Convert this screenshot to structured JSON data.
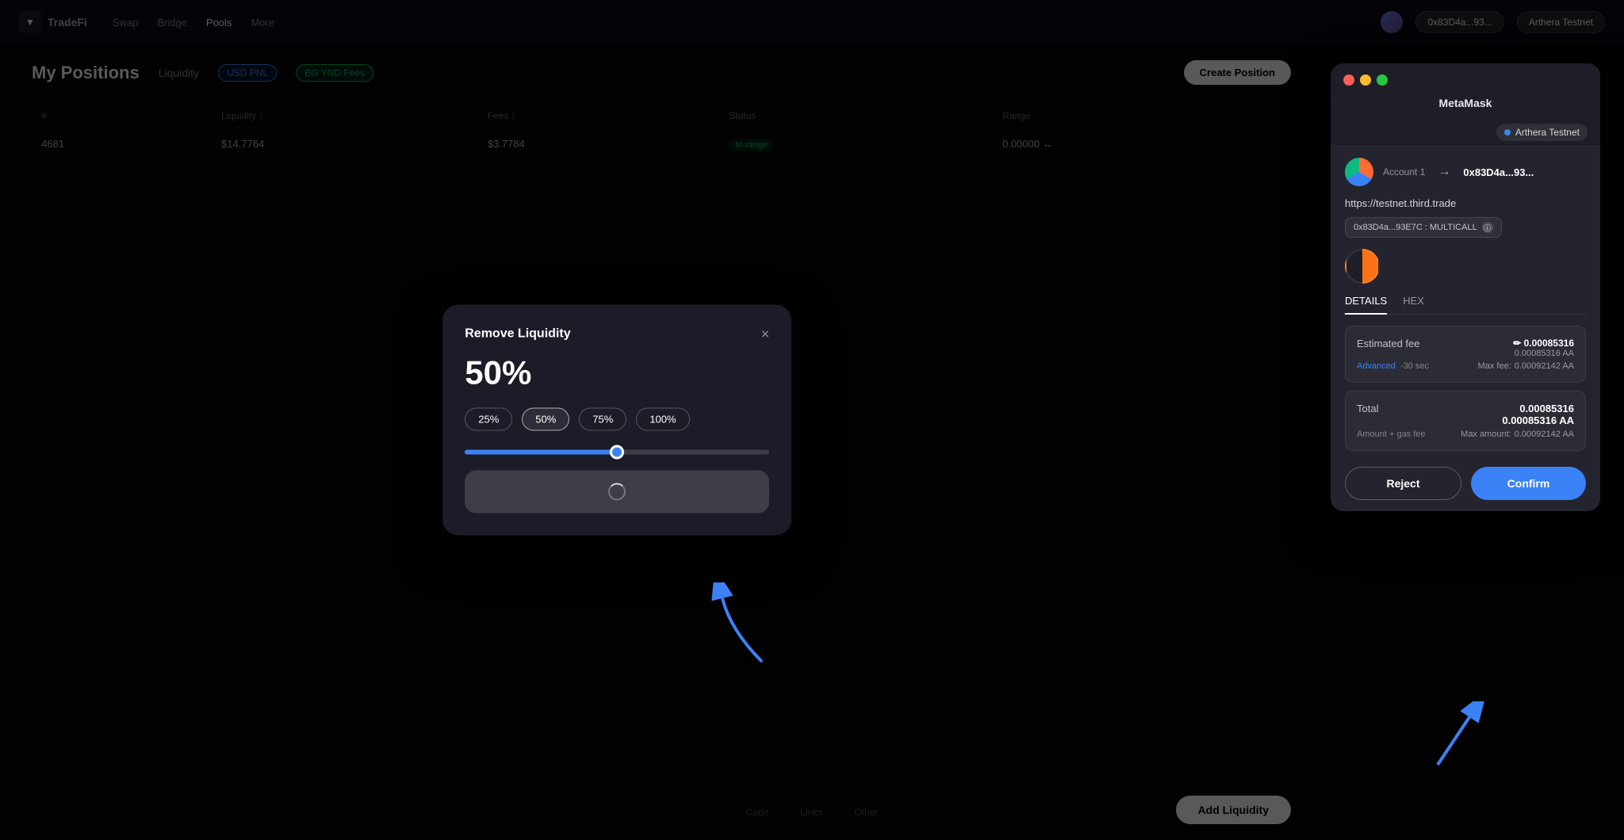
{
  "app": {
    "title": "TradeFi",
    "nav_links": [
      "Swap",
      "Bridge",
      "Pools",
      "More"
    ],
    "wallet_address": "0x83D4a...93...",
    "network_label": "Arthera Testnet"
  },
  "page": {
    "title": "My Positions",
    "tabs": [
      "Liquidity",
      "USD PNL",
      "BG YND Fees"
    ],
    "create_button": "Create Position",
    "table_headers": [
      "#",
      "Liquidity ↑",
      "Fees ↑",
      "Status",
      "Range"
    ],
    "table_row": {
      "id": "4681",
      "liquidity": "$14.7764",
      "fees": "$3.7784",
      "status": "In range",
      "range": "0.00000 ↔"
    }
  },
  "modal": {
    "title": "Remove Liquidity",
    "close_label": "×",
    "percent_display": "50%",
    "percent_buttons": [
      "25%",
      "50%",
      "75%",
      "100%"
    ],
    "active_percent": "50%",
    "slider_value": 50,
    "loading_button_label": ""
  },
  "metamask": {
    "window_title": "MetaMask",
    "network": "Arthera Testnet",
    "account_name": "Account 1",
    "address": "0x83D4a...93...",
    "url": "https://testnet.third.trade",
    "contract": "0x83D4a...93E7C : MULTICALL",
    "tabs": [
      "DETAILS",
      "HEX"
    ],
    "active_tab": "DETAILS",
    "estimated_fee_label": "Estimated fee",
    "estimated_fee_eth": "✏ 0.00085316",
    "estimated_fee_aa": "0.00085316 AA",
    "advanced_label": "Advanced",
    "advanced_time": "-30 sec",
    "max_fee_label": "Max fee:",
    "max_fee_value": "0.00092142 AA",
    "total_label": "Total",
    "total_eth": "0.00085316",
    "total_aa": "0.00085316 AA",
    "amount_gas_label": "Amount + gas fee",
    "max_amount_label": "Max amount:",
    "max_amount_value": "0.00092142 AA",
    "reject_button": "Reject",
    "confirm_button": "Confirm"
  },
  "bottom": {
    "links": [
      "Code",
      "Links",
      "Other"
    ],
    "add_liquidity": "Add Liquidity"
  },
  "colors": {
    "accent_blue": "#3b82f6",
    "success_green": "#00c864",
    "modal_bg": "#1c1c28",
    "metamask_bg": "#24242e"
  }
}
